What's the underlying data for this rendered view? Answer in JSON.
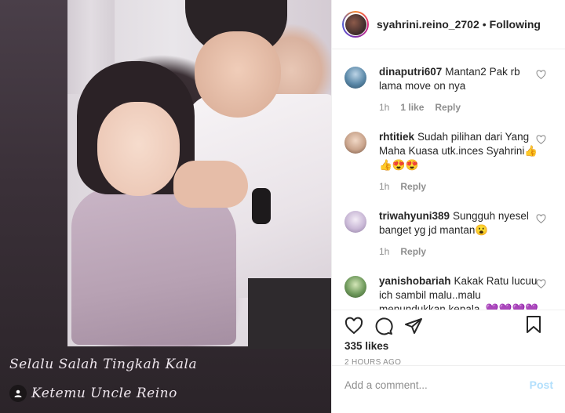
{
  "media": {
    "caption_line1": "Selalu Salah Tingkah Kala",
    "caption_line2": "Ketemu Uncle Reino"
  },
  "header": {
    "username": "syahrini.reino_2702",
    "separator": "•",
    "follow_status": "Following"
  },
  "comments": [
    {
      "username": "dinaputri607",
      "text": "Mantan2 Pak rb lama move on nya",
      "time": "1h",
      "likes": "1 like",
      "reply": "Reply",
      "avatar_color": "#5a88a8"
    },
    {
      "username": "rhtitiek",
      "text": "Sudah pilihan dari Yang Maha Kuasa utk.inces Syahrini👍👍😍😍",
      "time": "1h",
      "likes": "",
      "reply": "Reply",
      "avatar_color": "#c9a48c"
    },
    {
      "username": "triwahyuni389",
      "text": "Sungguh nyesel banget yg jd mantan😮",
      "time": "1h",
      "likes": "",
      "reply": "Reply",
      "avatar_color": "#c9b8d6"
    },
    {
      "username": "yanishobariah",
      "text": "Kakak Ratu lucuu ich sambil malu..malu menundukkan kepala..💜💜💜💜💜kok aku ja jadi grogi gini",
      "time": "",
      "likes": "",
      "reply": "",
      "avatar_color": "#6f9a5c"
    }
  ],
  "actions": {
    "likes_count": "335 likes",
    "timestamp": "2 HOURS AGO"
  },
  "comment_box": {
    "placeholder": "Add a comment...",
    "post_label": "Post"
  },
  "colors": {
    "post_disabled": "#b2dffc",
    "muted_text": "#8e8e8e",
    "border": "#efefef"
  }
}
